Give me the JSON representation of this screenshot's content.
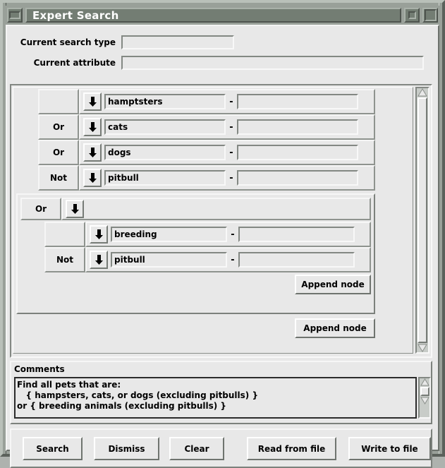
{
  "window": {
    "title": "Expert Search",
    "menu_button": "window-menu",
    "minimize_button": "minimize",
    "maximize_button": "maximize"
  },
  "top_panel": {
    "search_type": {
      "label": "Current search type",
      "value": "",
      "placeholder": ""
    },
    "attribute": {
      "label": "Current attribute",
      "value": "",
      "placeholder": ""
    }
  },
  "query": {
    "root_rows": [
      {
        "operator": "",
        "arrow": "down-arrow",
        "term": "hamptsters",
        "range_to": "",
        "dash": "-"
      },
      {
        "operator": "Or",
        "arrow": "down-arrow",
        "term": "cats",
        "range_to": "",
        "dash": "-"
      },
      {
        "operator": "Or",
        "arrow": "down-arrow",
        "term": "dogs",
        "range_to": "",
        "dash": "-"
      },
      {
        "operator": "Not",
        "arrow": "down-arrow",
        "term": "pitbull",
        "range_to": "",
        "dash": "-"
      }
    ],
    "subgroup": {
      "operator": "Or",
      "arrow": "down-arrow",
      "rows": [
        {
          "operator": "",
          "arrow": "down-arrow",
          "term": "breeding",
          "range_to": "",
          "dash": "-"
        },
        {
          "operator": "Not",
          "arrow": "down-arrow",
          "term": "pitbull",
          "range_to": "",
          "dash": "-"
        }
      ],
      "append_label": "Append node"
    },
    "append_label": "Append node",
    "scrollbar": {
      "up": "scroll-up-arrow",
      "down": "scroll-down-arrow"
    }
  },
  "comments": {
    "label": "Comments",
    "text": "Find all pets that are:\n   { hampsters, cats, or dogs (excluding pitbulls) }\nor { breeding animals (excluding pitbulls) }",
    "scrollbar": {
      "up": "scroll-up-arrow",
      "down": "scroll-down-arrow"
    }
  },
  "actions": [
    {
      "label": "Search"
    },
    {
      "label": "Dismiss"
    },
    {
      "label": "Clear"
    },
    {
      "label": "Read from file"
    },
    {
      "label": "Write to file"
    }
  ],
  "colors": {
    "face": "#e8e8e8",
    "frame": "#99a099",
    "titlebar": "#737d73",
    "title_text": "#ffffff",
    "shadow": "#7c817c",
    "highlight": "#ffffff",
    "text_border": "#2b2b2b"
  }
}
